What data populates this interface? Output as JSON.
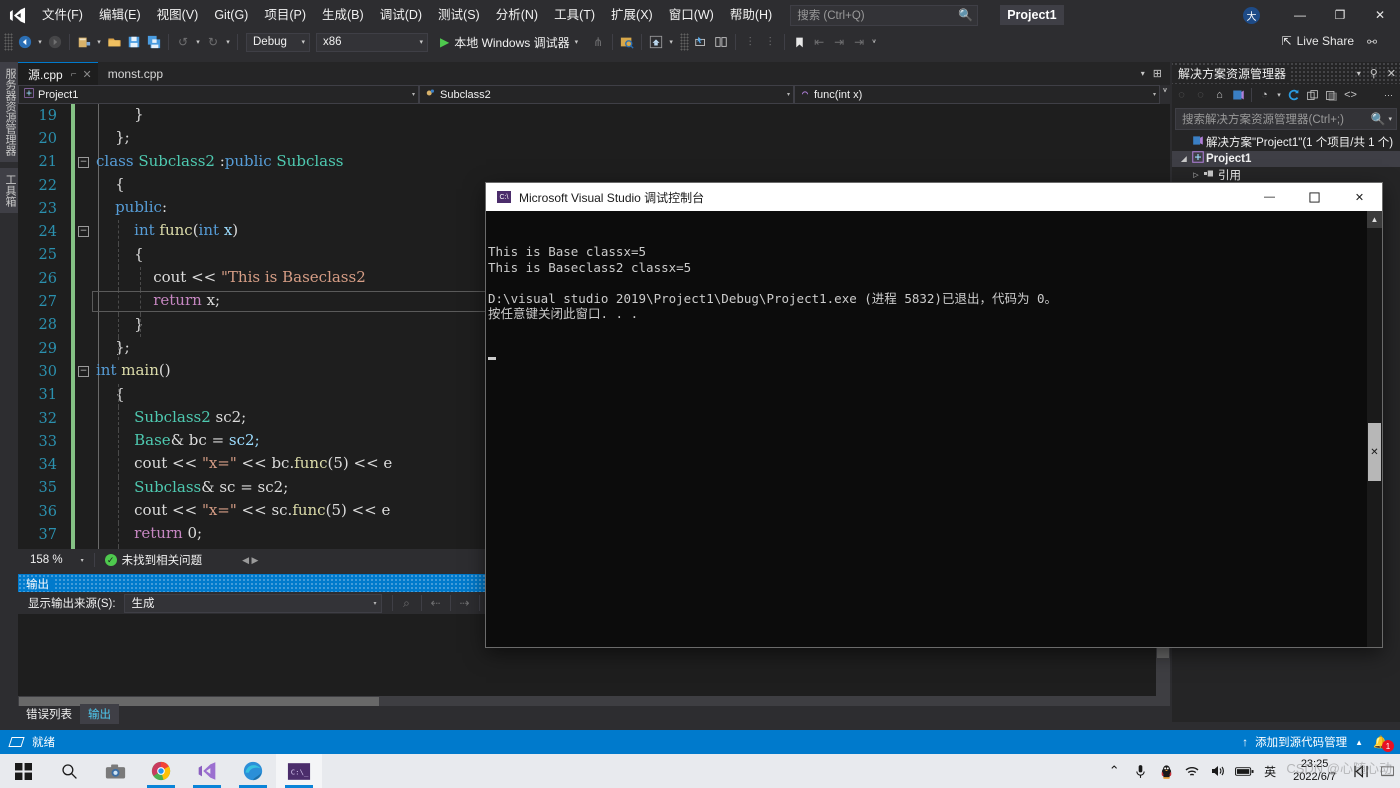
{
  "app": {
    "window_title": "Project1",
    "logo_icon": "visual-studio-logo"
  },
  "menubar": {
    "items": [
      {
        "label": "文件(F)"
      },
      {
        "label": "编辑(E)"
      },
      {
        "label": "视图(V)"
      },
      {
        "label": "Git(G)"
      },
      {
        "label": "项目(P)"
      },
      {
        "label": "生成(B)"
      },
      {
        "label": "调试(D)"
      },
      {
        "label": "测试(S)"
      },
      {
        "label": "分析(N)"
      },
      {
        "label": "工具(T)"
      },
      {
        "label": "扩展(X)"
      },
      {
        "label": "窗口(W)"
      },
      {
        "label": "帮助(H)"
      }
    ],
    "search_placeholder": "搜索 (Ctrl+Q)",
    "search_value": "",
    "account_initial": "大",
    "minimize": "—",
    "restore": "❐",
    "close": "✕"
  },
  "toolbar": {
    "config": {
      "value": "Debug"
    },
    "platform": {
      "value": "x86"
    },
    "run_label": "本地 Windows 调试器",
    "live_share": "Live Share"
  },
  "left_dock": {
    "tabs": [
      "服务器资源管理器",
      "工具箱"
    ]
  },
  "editor": {
    "tabs": [
      {
        "label": "源.cpp",
        "active": true,
        "pin": "⌐",
        "close": "✕"
      },
      {
        "label": "monst.cpp",
        "active": false
      }
    ],
    "navbar": [
      {
        "icon": "project-icon",
        "label": "Project1"
      },
      {
        "icon": "class-icon",
        "label": "Subclass2"
      },
      {
        "icon": "method-icon",
        "label": "func(int x)"
      }
    ],
    "lines": [
      {
        "num": "19",
        "fold": "",
        "tokens": [
          {
            "t": "        }",
            "c": "tk-plain"
          }
        ]
      },
      {
        "num": "20",
        "fold": "",
        "tokens": [
          {
            "t": "    };",
            "c": "tk-plain"
          }
        ]
      },
      {
        "num": "21",
        "fold": "−",
        "tokens": [
          {
            "t": "class ",
            "c": "tk-key"
          },
          {
            "t": "Subclass2",
            "c": "tk-type"
          },
          {
            "t": " :",
            "c": "tk-plain"
          },
          {
            "t": "public ",
            "c": "tk-key"
          },
          {
            "t": "Subclass",
            "c": "tk-type"
          }
        ]
      },
      {
        "num": "22",
        "fold": "",
        "tokens": [
          {
            "t": "    {",
            "c": "tk-plain"
          }
        ]
      },
      {
        "num": "23",
        "fold": "",
        "tokens": [
          {
            "t": "    public",
            "c": "tk-key"
          },
          {
            "t": ":",
            "c": "tk-plain"
          }
        ]
      },
      {
        "num": "24",
        "fold": "−",
        "tokens": [
          {
            "t": "        int ",
            "c": "tk-key"
          },
          {
            "t": "func",
            "c": "tk-fn"
          },
          {
            "t": "(",
            "c": "tk-plain"
          },
          {
            "t": "int ",
            "c": "tk-key"
          },
          {
            "t": "x",
            "c": "tk-var"
          },
          {
            "t": ")",
            "c": "tk-plain"
          }
        ]
      },
      {
        "num": "25",
        "fold": "",
        "tokens": [
          {
            "t": "        {",
            "c": "tk-plain"
          }
        ]
      },
      {
        "num": "26",
        "fold": "",
        "tokens": [
          {
            "t": "            cout",
            "c": "tk-plain"
          },
          {
            "t": " << ",
            "c": "tk-plain"
          },
          {
            "t": "\"This is Baseclass2",
            "c": "tk-str"
          }
        ]
      },
      {
        "num": "27",
        "fold": "",
        "tokens": [
          {
            "t": "            return",
            "c": "tk-kw2"
          },
          {
            "t": " x;",
            "c": "tk-plain"
          }
        ]
      },
      {
        "num": "28",
        "fold": "",
        "tokens": [
          {
            "t": "        }",
            "c": "tk-plain"
          }
        ]
      },
      {
        "num": "29",
        "fold": "",
        "tokens": [
          {
            "t": "    };",
            "c": "tk-plain"
          }
        ]
      },
      {
        "num": "30",
        "fold": "−",
        "tokens": [
          {
            "t": "int ",
            "c": "tk-key"
          },
          {
            "t": "main",
            "c": "tk-fn"
          },
          {
            "t": "()",
            "c": "tk-plain"
          }
        ]
      },
      {
        "num": "31",
        "fold": "",
        "tokens": [
          {
            "t": "    {",
            "c": "tk-plain"
          }
        ]
      },
      {
        "num": "32",
        "fold": "",
        "tokens": [
          {
            "t": "        Subclass2",
            "c": "tk-type"
          },
          {
            "t": " sc2;",
            "c": "tk-plain"
          }
        ]
      },
      {
        "num": "33",
        "fold": "",
        "tokens": [
          {
            "t": "        Base",
            "c": "tk-type"
          },
          {
            "t": "& bc = ",
            "c": "tk-plain"
          },
          {
            "t": "sc2;",
            "c": "tk-var"
          }
        ]
      },
      {
        "num": "34",
        "fold": "",
        "tokens": [
          {
            "t": "        cout << ",
            "c": "tk-plain"
          },
          {
            "t": "\"x=\"",
            "c": "tk-str"
          },
          {
            "t": " << bc.",
            "c": "tk-plain"
          },
          {
            "t": "func",
            "c": "tk-fn"
          },
          {
            "t": "(5) << e",
            "c": "tk-plain"
          }
        ]
      },
      {
        "num": "35",
        "fold": "",
        "tokens": [
          {
            "t": "        Subclass",
            "c": "tk-type"
          },
          {
            "t": "& sc = sc2;",
            "c": "tk-plain"
          }
        ]
      },
      {
        "num": "36",
        "fold": "",
        "tokens": [
          {
            "t": "        cout << ",
            "c": "tk-plain"
          },
          {
            "t": "\"x=\"",
            "c": "tk-str"
          },
          {
            "t": " << sc.",
            "c": "tk-plain"
          },
          {
            "t": "func",
            "c": "tk-fn"
          },
          {
            "t": "(5) << e",
            "c": "tk-plain"
          }
        ]
      },
      {
        "num": "37",
        "fold": "",
        "tokens": [
          {
            "t": "        return",
            "c": "tk-kw2"
          },
          {
            "t": " 0;",
            "c": "tk-plain"
          }
        ]
      },
      {
        "num": "38",
        "fold": "",
        "tokens": [
          {
            "t": "    }",
            "c": "tk-plain"
          }
        ]
      }
    ],
    "status": {
      "zoom": "158 %",
      "issue_icon": "check-circle-icon",
      "issue_text": "未找到相关问题"
    }
  },
  "output_pane": {
    "title": "输出",
    "source_label": "显示输出来源(S):",
    "source_value": "生成",
    "body_text": ""
  },
  "dock_tabs": [
    {
      "label": "错误列表",
      "active": false
    },
    {
      "label": "输出",
      "active": true
    }
  ],
  "solution_explorer": {
    "title": "解决方案资源管理器",
    "search_placeholder": "搜索解决方案资源管理器(Ctrl+;)",
    "tree": [
      {
        "twisty": "",
        "icon": "solution-icon",
        "label": "解决方案\"Project1\"(1 个项目/共 1 个)",
        "bold": false,
        "selected": false,
        "indent": 6
      },
      {
        "twisty": "◢",
        "icon": "cpp-project-icon",
        "label": "Project1",
        "bold": true,
        "selected": true,
        "indent": 6
      },
      {
        "twisty": "▷",
        "icon": "references-icon",
        "label": "引用",
        "bold": false,
        "selected": false,
        "indent": 18
      }
    ]
  },
  "status_bar": {
    "ready_text": "就绪",
    "source_control_text": "添加到源代码管理",
    "notification_count": "1"
  },
  "console_window": {
    "icon": "console-app-icon",
    "title": "Microsoft Visual Studio 调试控制台",
    "minimize": "—",
    "maximize": "❐",
    "close": "✕",
    "lines": [
      "This is Base classx=5",
      "This is Baseclass2 classx=5",
      "",
      "D:\\visual studio 2019\\Project1\\Debug\\Project1.exe (进程 5832)已退出，代码为 0。",
      "按任意键关闭此窗口. . ."
    ]
  },
  "taskbar": {
    "items": [
      {
        "icon": "windows-start-icon",
        "running": false,
        "active": false
      },
      {
        "icon": "search-icon",
        "running": false,
        "active": false
      },
      {
        "icon": "camera-icon",
        "running": false,
        "active": false
      },
      {
        "icon": "chrome-icon",
        "running": true,
        "active": false
      },
      {
        "icon": "visual-studio-icon",
        "running": true,
        "active": false
      },
      {
        "icon": "edge-icon",
        "running": true,
        "active": false
      },
      {
        "icon": "console-icon",
        "running": true,
        "active": true
      }
    ],
    "tray": [
      {
        "icon": "chevron-up-icon"
      },
      {
        "icon": "microphone-icon"
      },
      {
        "icon": "qq-penguin-icon"
      },
      {
        "icon": "wifi-icon"
      },
      {
        "icon": "volume-icon"
      },
      {
        "icon": "battery-icon"
      },
      {
        "icon": "ime-english-icon",
        "label": "英"
      }
    ],
    "clock_time": "23:25",
    "clock_date": "2022/6/7",
    "show_desktop_icon": "show-desktop-icon",
    "extra_icon": "media-icon",
    "watermark": "CSDN @心随心动"
  },
  "colors": {
    "accent": "#007acc",
    "editor_bg": "#1e1e1e",
    "chrome_bg": "#2d2d30",
    "console_bg": "#0c0c0c",
    "taskbar_bg": "#e8eaee",
    "badge_red": "#e81123",
    "change_bar_green": "#85c285"
  }
}
